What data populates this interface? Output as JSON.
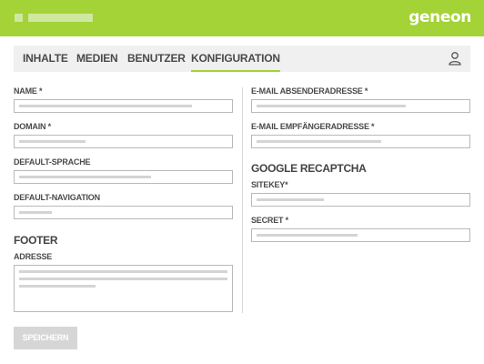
{
  "header": {
    "logo_text": "geneon",
    "brand_color": "#a3d336"
  },
  "nav": {
    "items": [
      {
        "label": "INHALTE",
        "active": false
      },
      {
        "label": "MEDIEN",
        "active": false
      },
      {
        "label": "BENUTZER",
        "active": false
      },
      {
        "label": "KONFIGURATION",
        "active": true
      }
    ],
    "user_icon": "user-icon"
  },
  "form": {
    "left": {
      "name_label": "NAME *",
      "domain_label": "DOMAIN *",
      "default_language_label": "DEFAULT-SPRACHE",
      "default_navigation_label": "DEFAULT-NAVIGATION",
      "footer_heading": "FOOTER",
      "address_label": "ADRESSE"
    },
    "right": {
      "sender_email_label": "E-MAIL ABSENDERADRESSE *",
      "recipient_email_label": "E-MAIL EMPFÄNGERADRESSE *",
      "recaptcha_heading": "GOOGLE RECAPTCHA",
      "sitekey_label": "SITEKEY*",
      "secret_label": "SECRET *"
    },
    "save_label": "SPEICHERN"
  }
}
